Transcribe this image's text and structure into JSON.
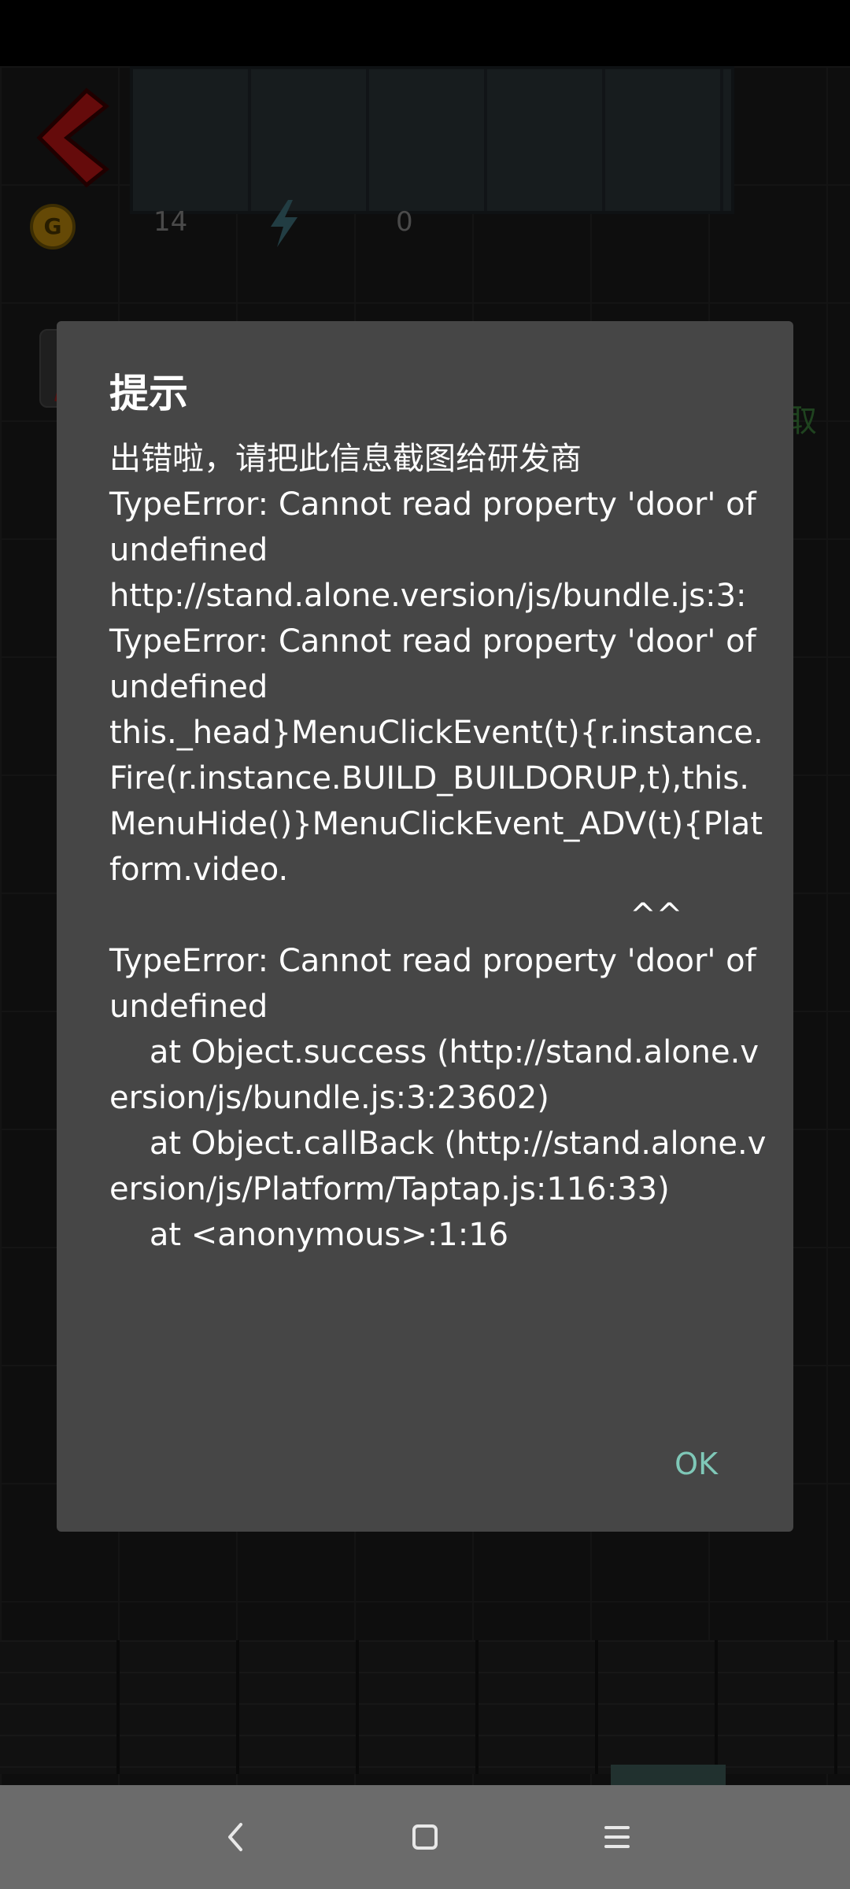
{
  "game": {
    "gold_count": "14",
    "energy_count": "0",
    "coin_letter": "G",
    "side_label": "取"
  },
  "dialog": {
    "title": "提示",
    "message": "出错啦，请把此信息截图给研发商\nTypeError: Cannot read property 'door' of undefined\nhttp://stand.alone.version/js/bundle.js:3:\nTypeError: Cannot read property 'door' of undefined\nthis._head}MenuClickEvent(t){r.instance.Fire(r.instance.BUILD_BUILDORUP,t),this.MenuHide()}MenuClickEvent_ADV(t){Platform.video.\n                                                    ^^\nTypeError: Cannot read property 'door' of undefined\n    at Object.success (http://stand.alone.version/js/bundle.js:3:23602)\n    at Object.callBack (http://stand.alone.version/js/Platform/Taptap.js:116:33)\n    at <anonymous>:1:16",
    "ok_label": "OK",
    "ok_color": "#7fc8b8"
  },
  "navbar": {
    "back_icon": "back-icon",
    "home_icon": "home-icon",
    "menu_icon": "menu-icon"
  }
}
